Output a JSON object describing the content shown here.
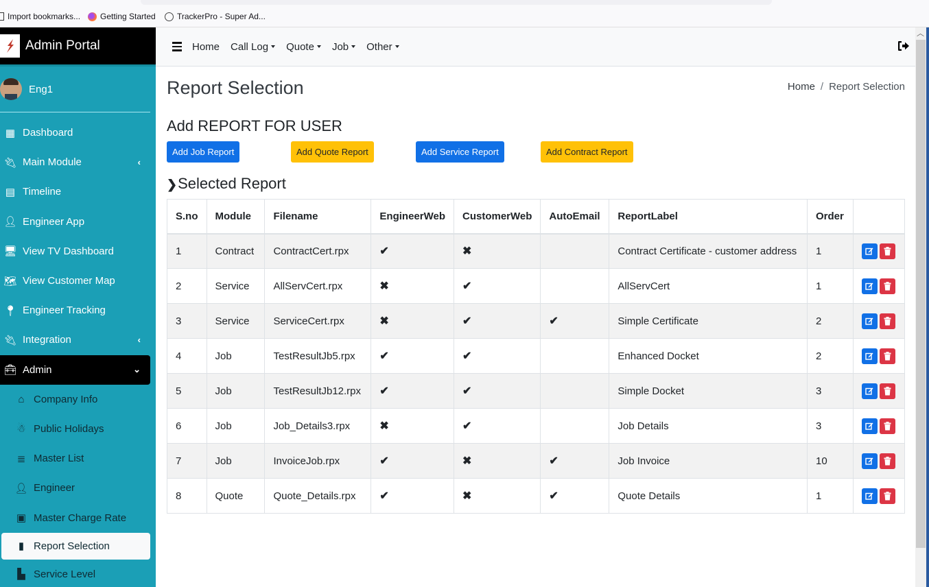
{
  "browser": {
    "bookmarks": [
      {
        "label": "Import bookmarks...",
        "icon": "import-icon"
      },
      {
        "label": "Getting Started",
        "icon": "firefox-icon"
      },
      {
        "label": "TrackerPro - Super Ad...",
        "icon": "globe-icon"
      }
    ]
  },
  "sidebar": {
    "brand": "Admin Portal",
    "user": "Eng1",
    "items": [
      {
        "label": "Dashboard",
        "icon": "grid-icon"
      },
      {
        "label": "Main Module",
        "icon": "plug-icon",
        "chevron": "‹"
      },
      {
        "label": "Timeline",
        "icon": "calendar-icon"
      },
      {
        "label": "Engineer App",
        "icon": "user-cog-icon"
      },
      {
        "label": "View TV Dashboard",
        "icon": "desktop-icon"
      },
      {
        "label": "View Customer Map",
        "icon": "map-icon"
      },
      {
        "label": "Engineer Tracking",
        "icon": "map-marker-icon"
      },
      {
        "label": "Integration",
        "icon": "plug-icon",
        "chevron": "‹"
      },
      {
        "label": "Admin",
        "icon": "toolbox-icon",
        "chevron": "⌄"
      }
    ],
    "sub_items": [
      {
        "label": "Company Info",
        "icon": "home-icon"
      },
      {
        "label": "Public Holidays",
        "icon": "snowman-icon"
      },
      {
        "label": "Master List",
        "icon": "database-icon"
      },
      {
        "label": "Engineer",
        "icon": "user-cog-icon"
      },
      {
        "label": "Master Charge Rate",
        "icon": "money-bill-icon"
      },
      {
        "label": "Report Selection",
        "icon": "file-icon",
        "active": true
      },
      {
        "label": "Service Level",
        "icon": "cubes-icon"
      }
    ]
  },
  "topbar": {
    "menu": [
      {
        "label": "Home",
        "dropdown": false
      },
      {
        "label": "Call Log",
        "dropdown": true
      },
      {
        "label": "Quote",
        "dropdown": true
      },
      {
        "label": "Job",
        "dropdown": true
      },
      {
        "label": "Other",
        "dropdown": true
      }
    ]
  },
  "page": {
    "title": "Report Selection",
    "breadcrumb": {
      "home": "Home",
      "separator": "/",
      "current": "Report Selection"
    },
    "section_title": "Add REPORT FOR USER",
    "buttons": {
      "add_job": "Add Job Report",
      "add_quote": "Add Quote Report",
      "add_service": "Add Service Report",
      "add_contract": "Add Contract Report"
    },
    "selected_title": "Selected Report",
    "selected_chevron": "›"
  },
  "table": {
    "headers": [
      "S.no",
      "Module",
      "Filename",
      "EngineerWeb",
      "CustomerWeb",
      "AutoEmail",
      "ReportLabel",
      "Order",
      ""
    ],
    "rows": [
      {
        "sno": "1",
        "module": "Contract",
        "filename": "ContractCert.rpx",
        "engineer_web": "✔",
        "customer_web": "✖",
        "auto_email": "",
        "label": "Contract Certificate - customer address",
        "order": "1"
      },
      {
        "sno": "2",
        "module": "Service",
        "filename": "AllServCert.rpx",
        "engineer_web": "✖",
        "customer_web": "✔",
        "auto_email": "",
        "label": "AllServCert",
        "order": "1"
      },
      {
        "sno": "3",
        "module": "Service",
        "filename": "ServiceCert.rpx",
        "engineer_web": "✖",
        "customer_web": "✔",
        "auto_email": "✔",
        "label": "Simple Certificate",
        "order": "2"
      },
      {
        "sno": "4",
        "module": "Job",
        "filename": "TestResultJb5.rpx",
        "engineer_web": "✔",
        "customer_web": "✔",
        "auto_email": "",
        "label": "Enhanced Docket",
        "order": "2"
      },
      {
        "sno": "5",
        "module": "Job",
        "filename": "TestResultJb12.rpx",
        "engineer_web": "✔",
        "customer_web": "✔",
        "auto_email": "",
        "label": "Simple Docket",
        "order": "3"
      },
      {
        "sno": "6",
        "module": "Job",
        "filename": "Job_Details3.rpx",
        "engineer_web": "✖",
        "customer_web": "✔",
        "auto_email": "",
        "label": "Job Details",
        "order": "3"
      },
      {
        "sno": "7",
        "module": "Job",
        "filename": "InvoiceJob.rpx",
        "engineer_web": "✔",
        "customer_web": "✖",
        "auto_email": "✔",
        "label": "Job Invoice",
        "order": "10"
      },
      {
        "sno": "8",
        "module": "Quote",
        "filename": "Quote_Details.rpx",
        "engineer_web": "✔",
        "customer_web": "✖",
        "auto_email": "✔",
        "label": "Quote Details",
        "order": "1"
      }
    ]
  },
  "colors": {
    "sidebar": "#1b9fb6",
    "primary": "#1170e6",
    "warning": "#ffc107",
    "danger": "#dc3545"
  }
}
